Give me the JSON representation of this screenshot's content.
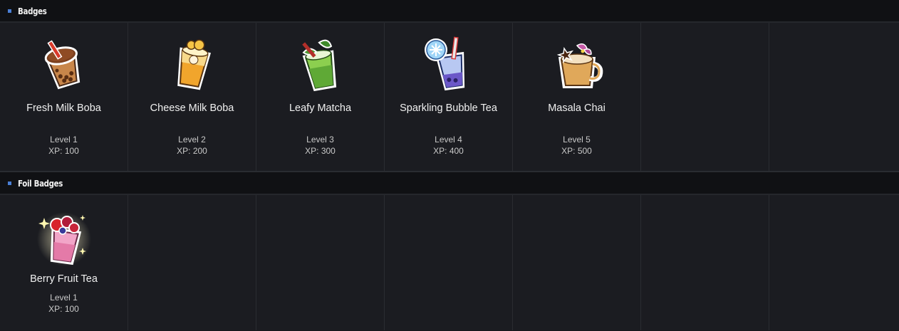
{
  "sections": [
    {
      "title": "Badges",
      "badges": [
        {
          "name": "Fresh Milk Boba",
          "level": "Level 1",
          "xp": "XP: 100",
          "icon": "boba-milk-tea-icon"
        },
        {
          "name": "Cheese Milk Boba",
          "level": "Level 2",
          "xp": "XP: 200",
          "icon": "cheese-milk-tea-icon"
        },
        {
          "name": "Leafy Matcha",
          "level": "Level 3",
          "xp": "XP: 300",
          "icon": "matcha-drink-icon"
        },
        {
          "name": "Sparkling Bubble Tea",
          "level": "Level 4",
          "xp": "XP: 400",
          "icon": "sparkling-bubble-tea-icon"
        },
        {
          "name": "Masala Chai",
          "level": "Level 5",
          "xp": "XP: 500",
          "icon": "masala-chai-icon"
        }
      ]
    },
    {
      "title": "Foil Badges",
      "badges": [
        {
          "name": "Berry Fruit Tea",
          "level": "Level 1",
          "xp": "XP: 100",
          "icon": "berry-fruit-tea-icon"
        }
      ]
    }
  ],
  "colors": {
    "accent": "#4a7fd6",
    "background": "#1b1c21",
    "header_background": "#101114"
  }
}
